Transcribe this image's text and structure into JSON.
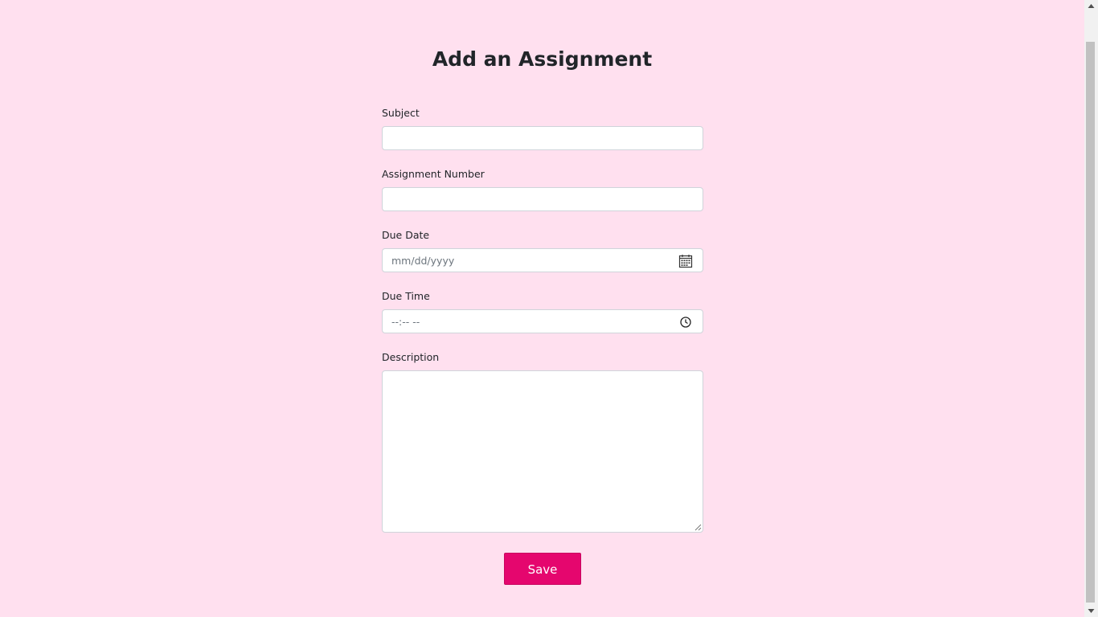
{
  "page": {
    "title": "Add an Assignment"
  },
  "form": {
    "subject": {
      "label": "Subject",
      "value": ""
    },
    "assignment_number": {
      "label": "Assignment Number",
      "value": ""
    },
    "due_date": {
      "label": "Due Date",
      "placeholder": "mm/dd/yyyy",
      "icon": "calendar-icon"
    },
    "due_time": {
      "label": "Due Time",
      "placeholder": "--:-- --",
      "icon": "clock-icon"
    },
    "description": {
      "label": "Description",
      "value": ""
    },
    "save_label": "Save"
  },
  "colors": {
    "background": "#ffe0ef",
    "button": "#e5066e",
    "button_text": "#ffffff",
    "input_border": "#cfd4da"
  }
}
